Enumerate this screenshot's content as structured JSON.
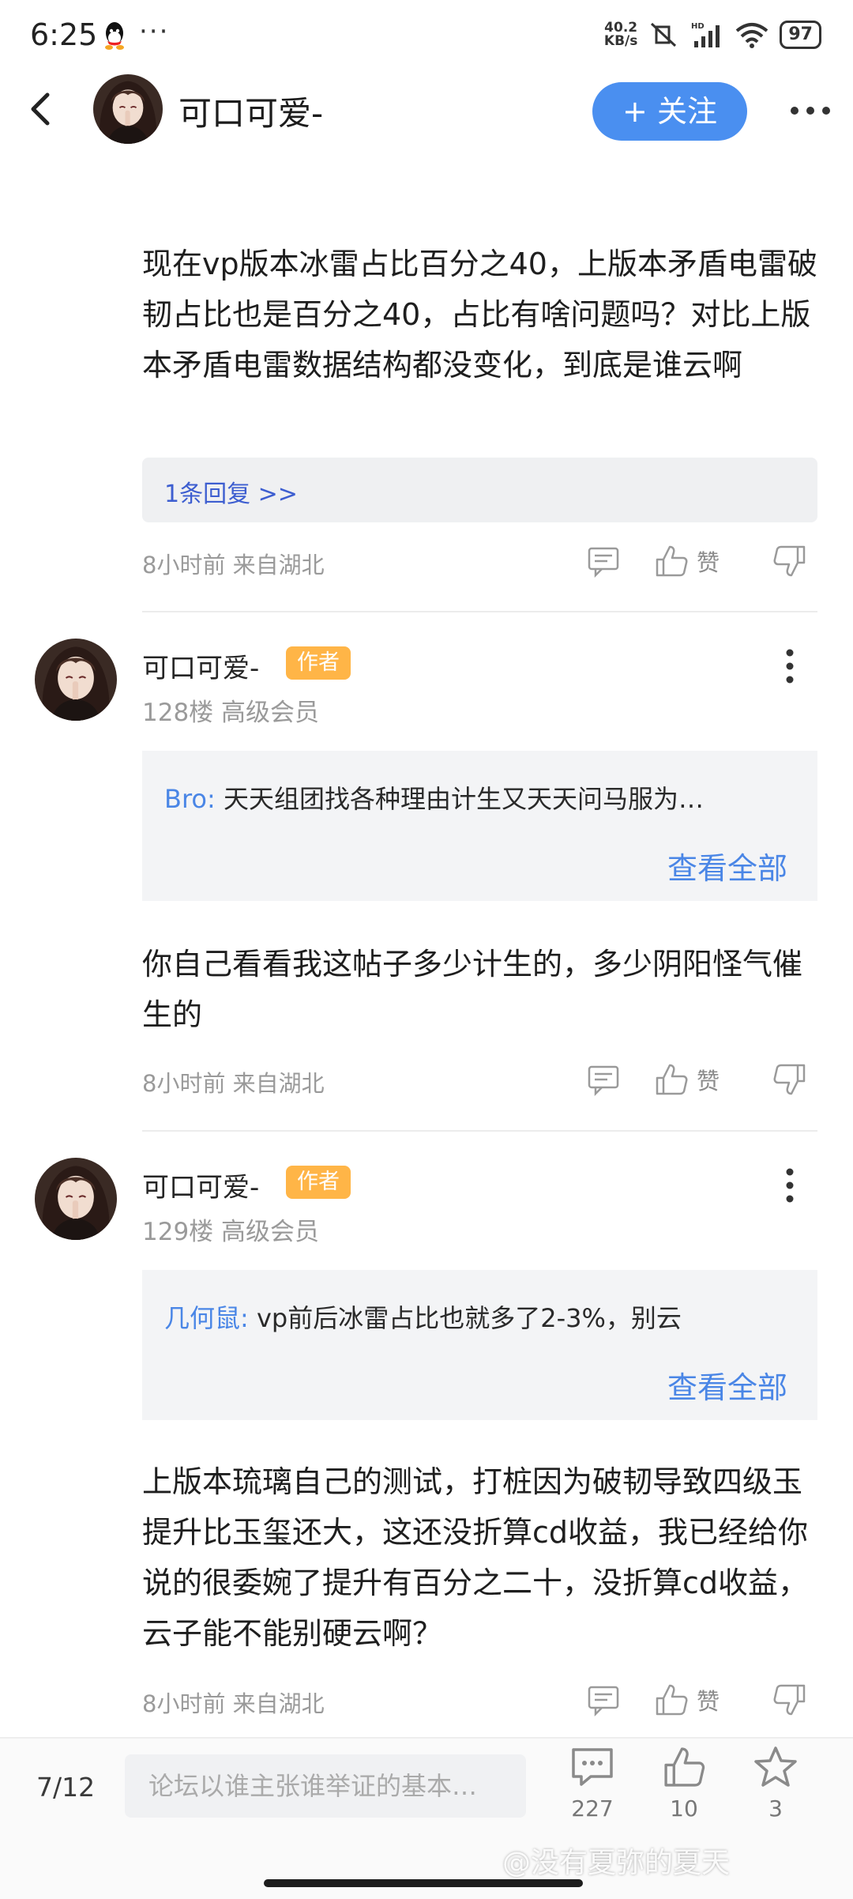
{
  "status_bar": {
    "time": "6:25",
    "more": "···",
    "net_speed_top": "40.2",
    "net_speed_unit": "KB/s",
    "battery": "97"
  },
  "header": {
    "username": "可口可爱-",
    "follow_label": "+ 关注"
  },
  "post_top": {
    "text": "现在vp版本冰雷占比百分之40，上版本矛盾电雷破韧占比也是百分之40，占比有啥问题吗？对比上版本矛盾电雷数据结构都没变化，到底是谁云啊",
    "replies_link": "1条回复 >>",
    "time_location": "8小时前 来自湖北",
    "like_label": "赞"
  },
  "comments": [
    {
      "username": "可口可爱-",
      "badge": "作者",
      "floor_info": "128楼 高级会员",
      "quote_author": "Bro:",
      "quote_text": "天天组团找各种理由计生又天天问马服为…",
      "view_all": "查看全部",
      "text": "你自己看看我这帖子多少计生的，多少阴阳怪气催生的",
      "time_location": "8小时前 来自湖北",
      "like_label": "赞"
    },
    {
      "username": "可口可爱-",
      "badge": "作者",
      "floor_info": "129楼 高级会员",
      "quote_author": "几何鼠:",
      "quote_text": "vp前后冰雷占比也就多了2-3%，别云",
      "view_all": "查看全部",
      "text": "上版本琉璃自己的测试，打桩因为破韧导致四级玉提升比玉玺还大，这还没折算cd收益，我已经给你说的很委婉了提升有百分之二十，没折算cd收益，云子能不能别硬云啊？",
      "time_location": "8小时前 来自湖北",
      "like_label": "赞"
    }
  ],
  "bottom_bar": {
    "page_indicator": "7/12",
    "input_placeholder": "论坛以谁主张谁举证的基本…",
    "comments_count": "227",
    "likes_count": "10",
    "favorites_count": "3"
  },
  "watermark": "@没有夏弥的夏天",
  "colors": {
    "accent": "#4a8ff0",
    "badge": "#ffb547",
    "link": "#4a86e6"
  }
}
